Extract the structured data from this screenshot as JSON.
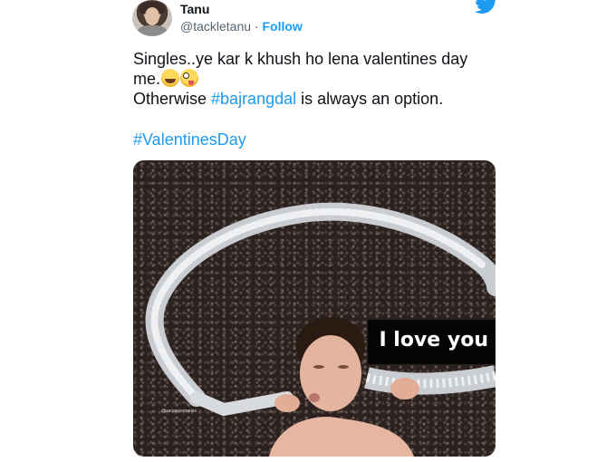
{
  "author": {
    "name": "Tanu",
    "handle": "@tackletanu",
    "separator": " · ",
    "follow_label": "Follow"
  },
  "icons": {
    "avatar": "profile-photo",
    "platform": "twitter-bird-icon",
    "emoji_1": "face-with-tears-of-joy",
    "emoji_2": "zany-face"
  },
  "tweet": {
    "line1": "Singles..ye kar k khush ho lena valentines day me.",
    "line2_prefix": "Otherwise ",
    "line2_hashtag": "#bajrangdal",
    "line2_suffix": " is always an option.",
    "hashtag": "#ValentinesDay"
  },
  "media": {
    "caption": "I love you",
    "watermark": "@sarjaayemaries"
  },
  "colors": {
    "link": "#1d9bf0",
    "text": "#0f1419",
    "secondary": "#536471",
    "caption_bg": "#050505"
  }
}
